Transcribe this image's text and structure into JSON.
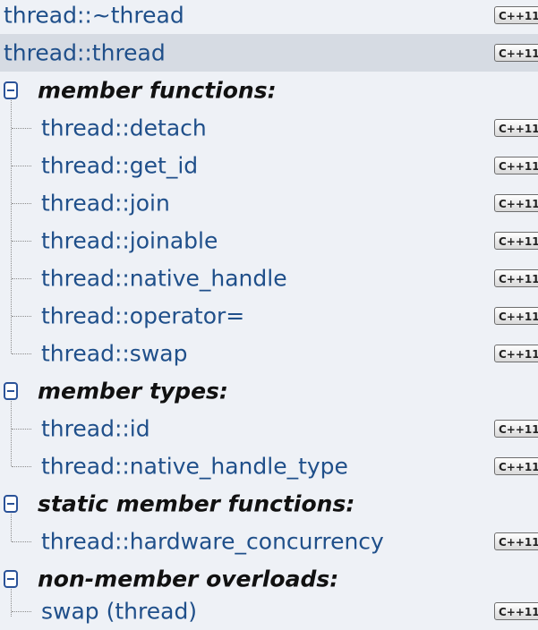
{
  "badge_label": "C++11",
  "top_items": [
    {
      "label": "thread::~thread"
    },
    {
      "label": "thread::thread",
      "selected": true
    }
  ],
  "sections": [
    {
      "title": "member functions:",
      "items": [
        {
          "label": "thread::detach"
        },
        {
          "label": "thread::get_id"
        },
        {
          "label": "thread::join"
        },
        {
          "label": "thread::joinable"
        },
        {
          "label": "thread::native_handle"
        },
        {
          "label": "thread::operator="
        },
        {
          "label": "thread::swap"
        }
      ]
    },
    {
      "title": "member types:",
      "items": [
        {
          "label": "thread::id"
        },
        {
          "label": "thread::native_handle_type"
        }
      ]
    },
    {
      "title": "static member functions:",
      "items": [
        {
          "label": "thread::hardware_concurrency"
        }
      ]
    },
    {
      "title": "non-member overloads:",
      "items": [
        {
          "label": "swap (thread)"
        }
      ]
    }
  ]
}
